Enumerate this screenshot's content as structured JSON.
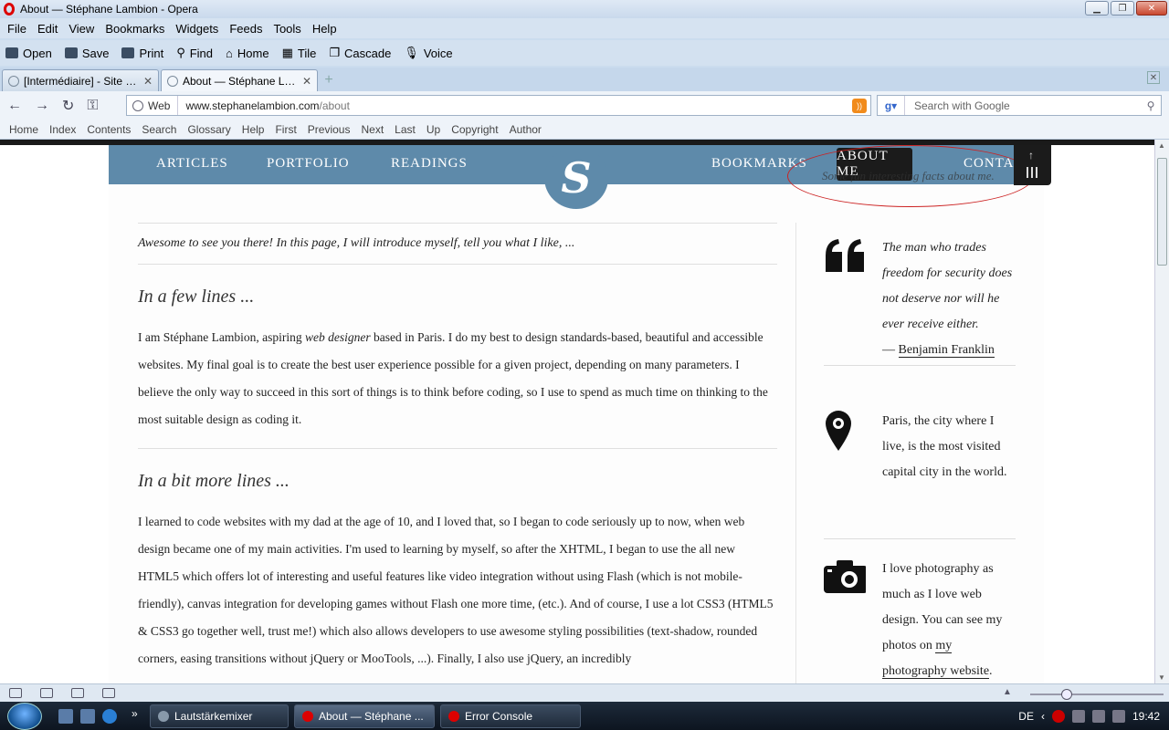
{
  "window": {
    "title": "About — Stéphane Lambion - Opera"
  },
  "menu": [
    "File",
    "Edit",
    "View",
    "Bookmarks",
    "Widgets",
    "Feeds",
    "Tools",
    "Help"
  ],
  "toolbar": [
    "Open",
    "Save",
    "Print",
    "Find",
    "Home",
    "Tile",
    "Cascade",
    "Voice"
  ],
  "tabs": [
    {
      "label": "[Intermédiaire] - Site p..."
    },
    {
      "label": "About — Stéphane La..."
    }
  ],
  "address": {
    "mode": "Web",
    "host": "www.stephanelambion.com",
    "path": "/about",
    "search_placeholder": "Search with Google"
  },
  "linkbar": [
    "Home",
    "Index",
    "Contents",
    "Search",
    "Glossary",
    "Help",
    "First",
    "Previous",
    "Next",
    "Last",
    "Up",
    "Copyright",
    "Author"
  ],
  "site": {
    "nav": [
      "ARTICLES",
      "PORTFOLIO",
      "READINGS",
      "BOOKMARKS",
      "ABOUT ME",
      "CONTACT"
    ],
    "logo": "S",
    "tagline": "Some fun interesting facts about me.",
    "intro": "Awesome to see you there! In this page, I will introduce myself, tell you what I like, ...",
    "section1_title": "In a few lines ...",
    "section1_pre": "I am Stéphane Lambion, aspiring ",
    "section1_em": "web designer",
    "section1_post": " based in Paris. I do my best to design standards-based, beautiful and accessible websites. My final goal is to create the best user experience possible for a given project, depending on many parameters. I believe the only way to succeed in this sort of things is to think before coding, so I use to spend as much time on thinking to the most suitable design as coding it.",
    "section2_title": "In a bit more lines ...",
    "section2_text": "I learned to code websites with my dad at the age of 10, and I loved that, so I began to code seriously up to now, when web design became one of my main activities. I'm used to learning by myself, so after the XHTML, I began to use the all new HTML5 which offers lot of interesting and useful features like video integration without using Flash (which is not mobile-friendly), canvas integration for developing games without Flash one more time, (etc.). And of course, I use a lot CSS3 (HTML5 & CSS3 go together well, trust me!) which also allows developers to use awesome styling possibilities (text-shadow, rounded corners, easing transitions without jQuery or MooTools, ...). Finally, I also use jQuery, an incredibly",
    "aside": {
      "quote": "The man who trades freedom for security does not deserve nor will he ever receive either.",
      "quote_dash": "— ",
      "quote_author": "Benjamin Franklin",
      "paris": "Paris, the city where I live, is the most visited capital city in the world.",
      "photo_pre": "I love photography as much as I love web design. You can see my photos on ",
      "photo_link": "my photography website",
      "photo_post": "."
    }
  },
  "taskbar": {
    "tasks": [
      "Lautstärkemixer",
      "About — Stéphane ...",
      "Error Console"
    ],
    "lang": "DE",
    "time": "19:42"
  },
  "colors": {
    "site_nav": "#5e8aaa",
    "active_nav": "#1b1b1b",
    "highlight": "#cc2222"
  }
}
